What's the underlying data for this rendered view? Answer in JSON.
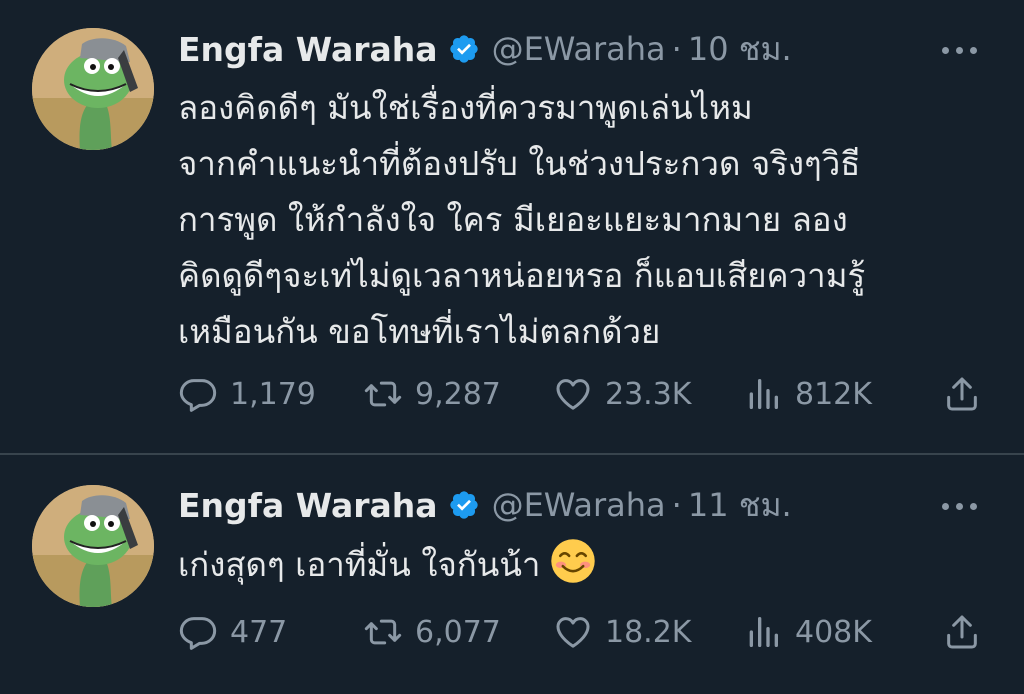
{
  "tweets": [
    {
      "name": "Engfa Waraha",
      "handle": "@EWaraha",
      "time": "10 ชม.",
      "lines": [
        "ลองคิดดีๆ มันใช่เรื่องที่ควรมาพูดเล่นไหม",
        "จากคำแนะนำที่ต้องปรับ ในช่วงประกวด จริงๆวิธี",
        "การพูด ให้กำลังใจ ใคร มีเยอะแยะมากมาย ลอง",
        "คิดดูดีๆจะเท่ไม่ดูเวลาหน่อยหรอ ก็แอบเสียความรู้",
        "เหมือนกัน ขอโทษที่เราไม่ตลกด้วย"
      ],
      "replies": "1,179",
      "retweets": "9,287",
      "likes": "23.3K",
      "views": "812K"
    },
    {
      "name": "Engfa Waraha",
      "handle": "@EWaraha",
      "time": "11 ชม.",
      "lines": [
        "เก่งสุดๆ เอาที่มั่น ใจกันน้า"
      ],
      "emoji": "smiling-face-emoji",
      "replies": "477",
      "retweets": "6,077",
      "likes": "18.2K",
      "views": "408K"
    }
  ],
  "colors": {
    "background": "#15202b",
    "text": "#e7e9ea",
    "muted": "#8b98a5",
    "verified": "#1d9bf0",
    "divider": "#38444d"
  },
  "icons": [
    "reply-icon",
    "retweet-icon",
    "like-icon",
    "views-icon",
    "share-icon",
    "more-icon",
    "verified-badge-icon"
  ]
}
